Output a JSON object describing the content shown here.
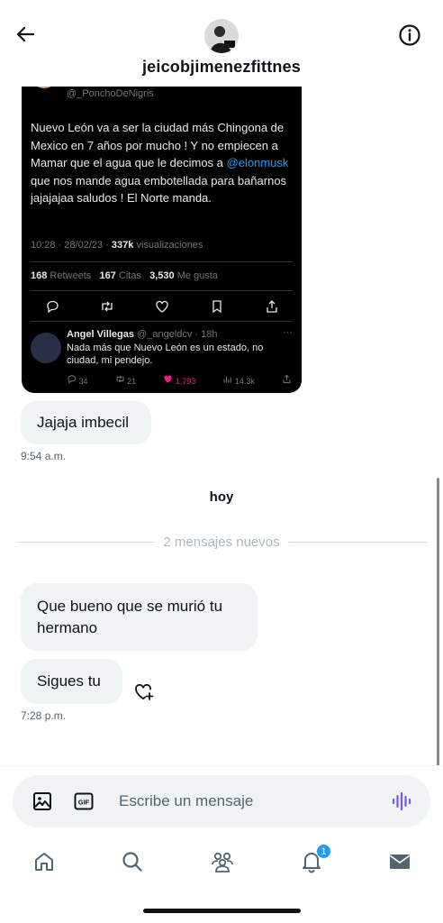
{
  "header": {
    "username": "jeicobjimenezfittnes"
  },
  "tweet": {
    "handle": "@_PonchoDeNigris",
    "text_before": "Nuevo León va a ser la ciudad más Chingona de Mexico en 7 años por mucho ! Y no empiecen a Mamar que el agua que le decimos a ",
    "mention": "@elonmusk",
    "text_after": " que nos mande agua embotellada para bañarnos jajajajaa saludos ! El Norte manda.",
    "time": "10:28 · 28/02/23 · ",
    "views_count": "337k",
    "views_label": " visualizaciones",
    "retweets_count": "168",
    "retweets_label": " Retweets",
    "quotes_count": "167",
    "quotes_label": " Citas",
    "likes_count": "3,530",
    "likes_label": " Me gusta",
    "reply": {
      "name": "Angel Villegas",
      "handle_time": " @_angeldcv · 18h",
      "dots": "···",
      "text": "Nada más que Nuevo León es un estado, no ciudad, mi pendejo.",
      "replies": "34",
      "retweets": "21",
      "likes": "1,793",
      "views": "14.3k"
    }
  },
  "messages": {
    "m1": "Jajaja imbecil",
    "m1_time": "9:54 a.m.",
    "day_label": "hoy",
    "new_messages": "2 mensajes nuevos",
    "m2": "Que bueno que se murió tu hermano",
    "m3": "Sigues tu",
    "m3_time": "7:28 p.m."
  },
  "composer": {
    "placeholder": "Escribe un mensaje",
    "gif_label": "GIF"
  },
  "nav": {
    "notifications_badge": "1"
  },
  "icons": {
    "back": "arrow-left-icon",
    "info": "info-icon",
    "image": "image-icon",
    "gif": "gif-icon",
    "voice": "voice-wave-icon",
    "home": "home-icon",
    "search": "search-icon",
    "communities": "people-icon",
    "notifications": "bell-icon",
    "messages": "envelope-icon",
    "reaction": "heart-plus-icon"
  },
  "colors": {
    "accent": "#1d9bf0",
    "bubble": "#eff3f4",
    "voice": "#7856ff"
  }
}
